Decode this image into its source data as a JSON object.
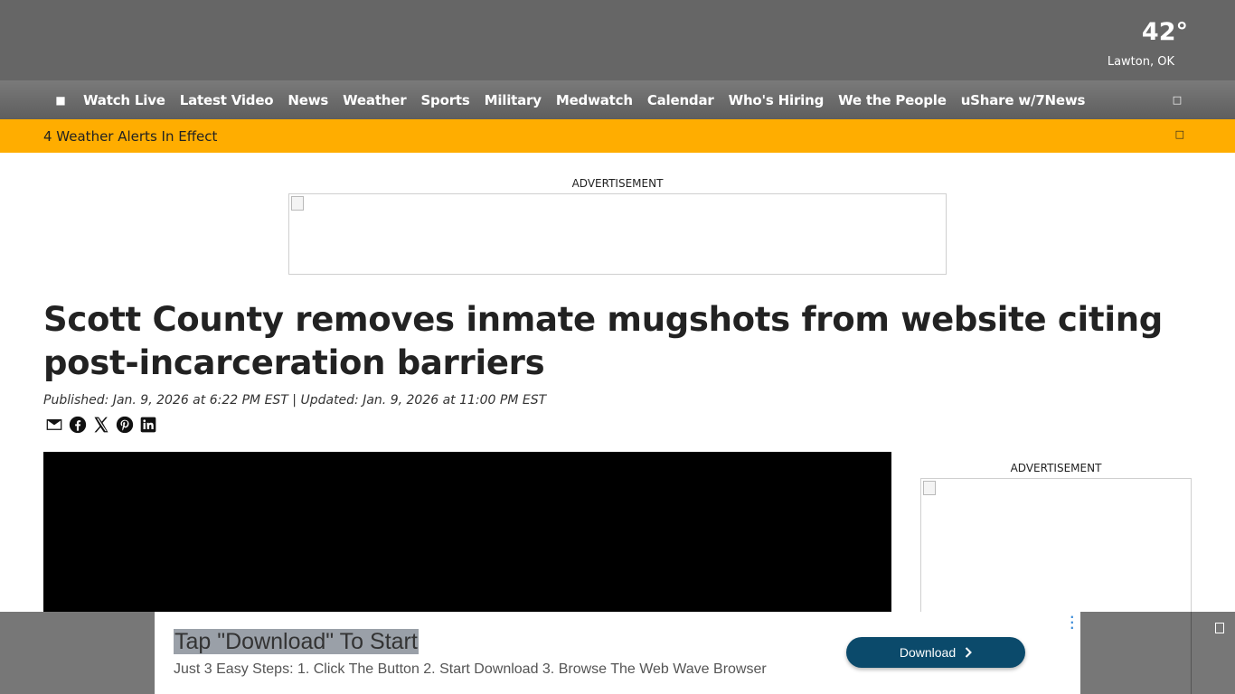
{
  "weather": {
    "temperature": "42°",
    "location": "Lawton, OK"
  },
  "nav": {
    "items": [
      "Watch Live",
      "Latest Video",
      "News",
      "Weather",
      "Sports",
      "Military",
      "Medwatch",
      "Calendar",
      "Who's Hiring",
      "We the People",
      "uShare w/7News"
    ]
  },
  "alert": {
    "text": "4 Weather Alerts In Effect"
  },
  "ads": {
    "top_label": "ADVERTISEMENT",
    "side_label": "ADVERTISEMENT"
  },
  "article": {
    "headline": "Scott County removes inmate mugshots from website citing post-incarceration barriers",
    "meta": "Published: Jan. 9, 2026 at 6:22 PM EST | Updated: Jan. 9, 2026 at 11:00 PM EST",
    "share_icons": [
      "email-icon",
      "facebook-icon",
      "x-icon",
      "pinterest-icon",
      "linkedin-icon"
    ]
  },
  "bottom_ad": {
    "title": "Tap \"Download\" To Start",
    "subtitle": "Just 3 Easy Steps: 1. Click The Button 2. Start Download 3. Browse The Web Wave Browser",
    "button_label": "Download",
    "button_color": "#0b4a6b"
  },
  "colors": {
    "topbar": "#666666",
    "alert": "#ffad00"
  }
}
